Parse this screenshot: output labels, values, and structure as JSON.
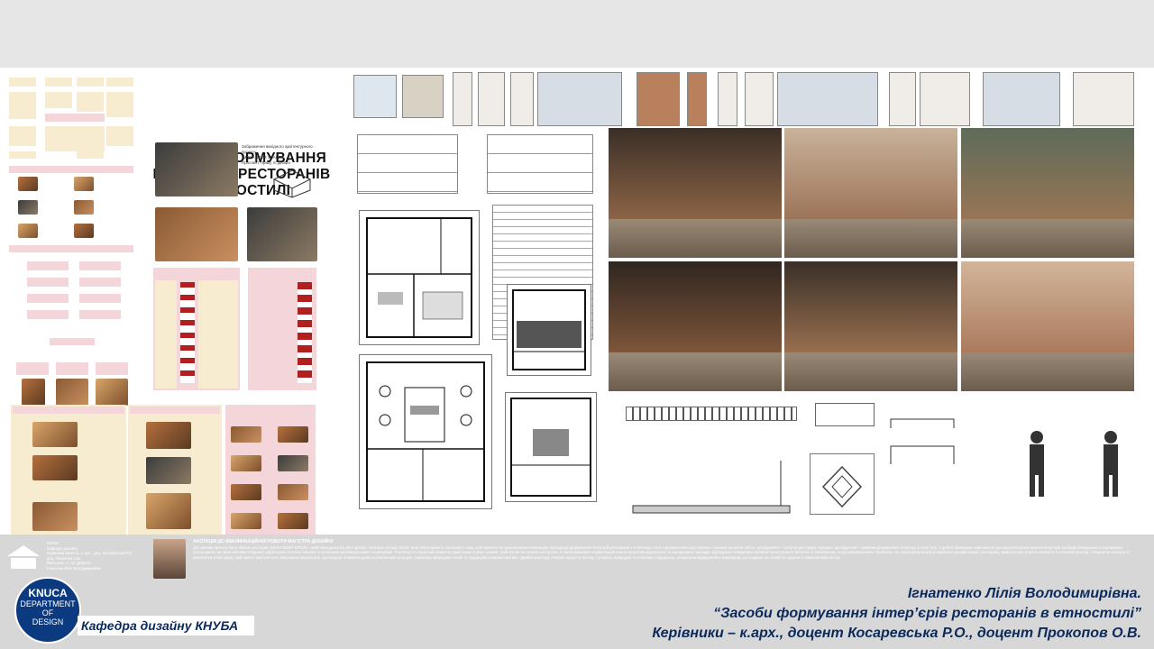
{
  "poster": {
    "title_lines": [
      "ЗАСОБИ ФОРМУВАННЯ",
      "ІНТЕР’ЄРІВ РЕСТОРАНІВ",
      "В ЕТНОСТИЛІ"
    ],
    "project_caption_1": "Зображення вихідного архітектурного проекту",
    "project_caption_2": "\"MOVA BEER SPACE\"",
    "project_caption_3": "Проспект Праці, 6, Дніпро"
  },
  "footer": {
    "logo_knuca": "KNUCA",
    "logo_department": "DEPARTMENT",
    "logo_of": "OF",
    "logo_design": "DESIGN",
    "department_label": "Кафедра дизайну КНУБА",
    "author_name": "Ігнатенко Лілія Володимирівна.",
    "thesis_title": "“Засоби формування інтер’єрів ресторанів в етностилі”",
    "supervisors": "Керівники – к.арх., доцент Косаревська Р.О., доцент Прокопов О.В.",
    "annotation_title": "АНОТАЦІЯ ДО КВАЛІФІКАЦІЙНОЇ РОБОТИ МАГІСТРА ДИЗАЙНУ",
    "annotation_text": "Для дизайн проекту було обрано ресторан «MOVA BEER SPACE», який знаходиться в місті Дніпро. Загальна площа 765,87 кв.м. Мета проекту полягала в тому, щоб вивчити та проаналізувати еволюцію підходів до формування інтер’єрів ресторанів в етнічному стилі з урахуванням просторових і часових аспектів. Об’єкт дослідження – інтер’єр ресторану. Предмет дослідження – прийоми формування інтер’єру в етностилі. У роботі проведено комплексне дослідження проектування інтер’єрів закладів громадського харчування, зосереджене на гармонійному поєднанні українських етнічних мотивів із сучасними дизайнерськими тенденціями. Розглянуто історичний розвиток українських корчм і шинків, їхній вплив на сучасні ресторани, а також виконано порівняльний аналіз інтер’єрів українських та закордонних закладів. Досліджено нормативні аспекти проектування, включно із зонуванням, енергозбереженням і безпекою. На основі результатів розроблено дизайн-проект ресторану, який інтегрує етнічні елементи в сучасний простір, створюючи затишну й автентичну атмосферу. Цей проект вирізняється унікальною концепцією, що поєднує елементи давньослов’янської культури, символіку природних стихій та традиційні ремісничі мотиви. Дизайн простору створює відчуття зв’язку з історією, природою та етнічною спадщиною, занурюючи відвідувачів у атмосферу, що надихає на спокій та єднання з навколишнім світом.",
    "small_info_1": "КНУБА",
    "small_info_2": "Кафедра дизайну",
    "small_info_3": "Керівники проекту: к. арх., доц. Косаревська Р.О.",
    "small_info_4": "доц. Прокопов О.В.",
    "small_info_5": "Виконала: ст. гр. ДІЗм-23",
    "small_info_6": "Ігнатенко Лілія Володимирівна"
  },
  "colors": {
    "navy": "#0b2a5a",
    "logo_blue": "#0c3a80",
    "pink_panel": "#f4d6da",
    "beige_panel": "#f8ecd0"
  },
  "icons": [
    "knuca-logo-icon",
    "building-icon"
  ]
}
